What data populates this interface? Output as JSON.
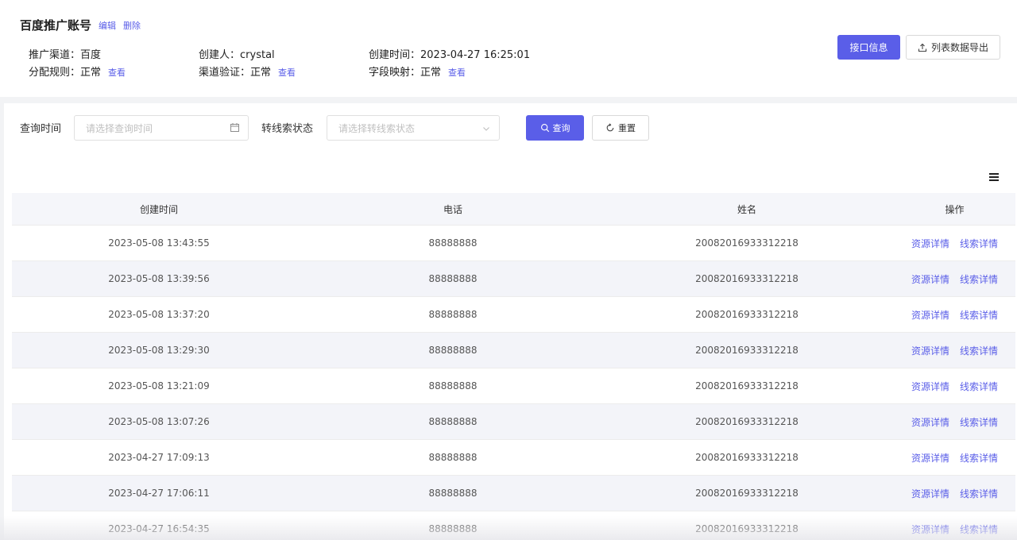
{
  "header": {
    "title": "百度推广账号",
    "edit_label": "编辑",
    "delete_label": "删除",
    "info": {
      "channel_label": "推广渠道：",
      "channel_value": "百度",
      "creator_label": "创建人：",
      "creator_value": "crystal",
      "created_time_label": "创建时间：",
      "created_time_value": "2023-04-27 16:25:01",
      "rule_label": "分配规则：",
      "rule_value": "正常",
      "verify_label": "渠道验证：",
      "verify_value": "正常",
      "mapping_label": "字段映射：",
      "mapping_value": "正常",
      "view_label": "查看"
    },
    "api_info_button": "接口信息",
    "export_button": "列表数据导出"
  },
  "filters": {
    "time_label": "查询时间",
    "time_placeholder": "请选择查询时间",
    "status_label": "转线索状态",
    "status_placeholder": "请选择转线索状态",
    "query_button": "查询",
    "reset_button": "重置"
  },
  "table": {
    "columns": [
      "创建时间",
      "电话",
      "姓名",
      "操作"
    ],
    "action_resource": "资源详情",
    "action_lead": "线索详情",
    "rows": [
      {
        "time": "2023-05-08 13:43:55",
        "phone": "88888888",
        "name": "20082016933312218"
      },
      {
        "time": "2023-05-08 13:39:56",
        "phone": "88888888",
        "name": "20082016933312218"
      },
      {
        "time": "2023-05-08 13:37:20",
        "phone": "88888888",
        "name": "20082016933312218"
      },
      {
        "time": "2023-05-08 13:29:30",
        "phone": "88888888",
        "name": "20082016933312218"
      },
      {
        "time": "2023-05-08 13:21:09",
        "phone": "88888888",
        "name": "20082016933312218"
      },
      {
        "time": "2023-05-08 13:07:26",
        "phone": "88888888",
        "name": "20082016933312218"
      },
      {
        "time": "2023-04-27 17:09:13",
        "phone": "88888888",
        "name": "20082016933312218"
      },
      {
        "time": "2023-04-27 17:06:11",
        "phone": "88888888",
        "name": "20082016933312218"
      },
      {
        "time": "2023-04-27 16:54:35",
        "phone": "88888888",
        "name": "20082016933312218"
      }
    ]
  },
  "icons": {
    "calendar": "calendar-icon",
    "chevron": "chevron-down-icon",
    "search": "search-icon",
    "reset": "refresh-icon",
    "export": "upload-icon",
    "settings": "column-settings-icon"
  },
  "colors": {
    "accent": "#5a5ee8",
    "page_bg": "#f2f3f5",
    "row_alt": "#f3f4f9"
  }
}
